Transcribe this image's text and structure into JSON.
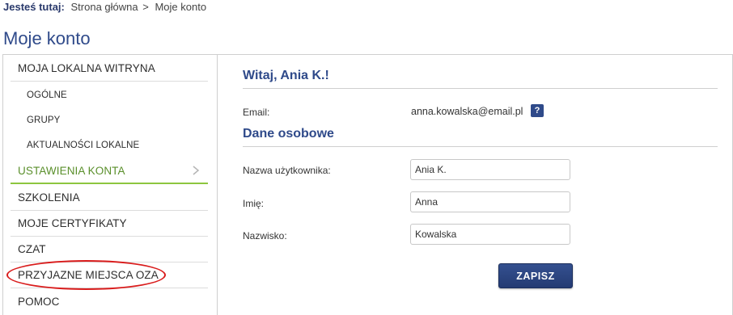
{
  "breadcrumb": {
    "label": "Jesteś tutaj:",
    "home": "Strona główna",
    "separator": ">",
    "current": "Moje konto"
  },
  "page_title": "Moje konto",
  "sidebar": {
    "items": [
      {
        "label": "MOJA LOKALNA WITRYNA",
        "level": "top"
      },
      {
        "label": "OGÓLNE",
        "level": "sub"
      },
      {
        "label": "GRUPY",
        "level": "sub"
      },
      {
        "label": "AKTUALNOŚCI LOKALNE",
        "level": "sub"
      },
      {
        "label": "USTAWIENIA KONTA",
        "level": "top",
        "active": true
      },
      {
        "label": "SZKOLENIA",
        "level": "top"
      },
      {
        "label": "MOJE CERTYFIKATY",
        "level": "top"
      },
      {
        "label": "CZAT",
        "level": "top"
      },
      {
        "label": "PRZYJAZNE MIEJSCA OZA",
        "level": "top",
        "highlighted": true
      },
      {
        "label": "POMOC",
        "level": "top"
      }
    ],
    "active_color": "#5a8f2b",
    "highlight_color": "#d91c1c"
  },
  "main": {
    "greeting": "Witaj, Ania K.!",
    "email_label": "Email:",
    "email_value": "anna.kowalska@email.pl",
    "help_label": "?",
    "section_personal": "Dane osobowe",
    "fields": {
      "username": {
        "label": "Nazwa użytkownika:",
        "value": "Ania K."
      },
      "first_name": {
        "label": "Imię:",
        "value": "Anna"
      },
      "last_name": {
        "label": "Nazwisko:",
        "value": "Kowalska"
      }
    },
    "save_label": "ZAPISZ"
  },
  "colors": {
    "brand": "#2f4a8a",
    "accent_green": "#8dc63f"
  }
}
